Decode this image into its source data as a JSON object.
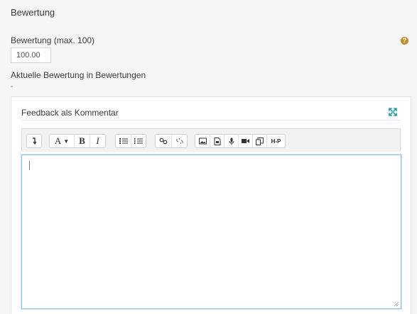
{
  "section": {
    "title": "Bewertung"
  },
  "grade": {
    "label": "Bewertung (max. 100)",
    "value": "100.00",
    "help_icon": "question-circle-icon"
  },
  "current_grade": {
    "label": "Aktuelle Bewertung in Bewertungen",
    "value": "-"
  },
  "feedback": {
    "title": "Feedback als Kommentar",
    "expand_icon": "fullscreen-expand-icon",
    "editor_content": ""
  },
  "toolbar": {
    "groups": [
      [
        "collapse-icon"
      ],
      [
        "paragraph-style-icon",
        "bold-icon",
        "italic-icon"
      ],
      [
        "unordered-list-icon",
        "ordered-list-icon"
      ],
      [
        "link-icon",
        "unlink-icon"
      ],
      [
        "image-icon",
        "media-file-icon",
        "record-audio-icon",
        "record-video-icon",
        "manage-files-icon",
        "h5p-icon"
      ]
    ],
    "labels": {
      "bold": "B",
      "italic": "I",
      "paragraph": "A",
      "h5p": "H-P"
    }
  },
  "colors": {
    "panel_bg": "#f6f6f6",
    "help_icon": "#c18e2b",
    "expand_icon": "#1f9f9f",
    "editor_focus_border": "#85c6e0"
  }
}
